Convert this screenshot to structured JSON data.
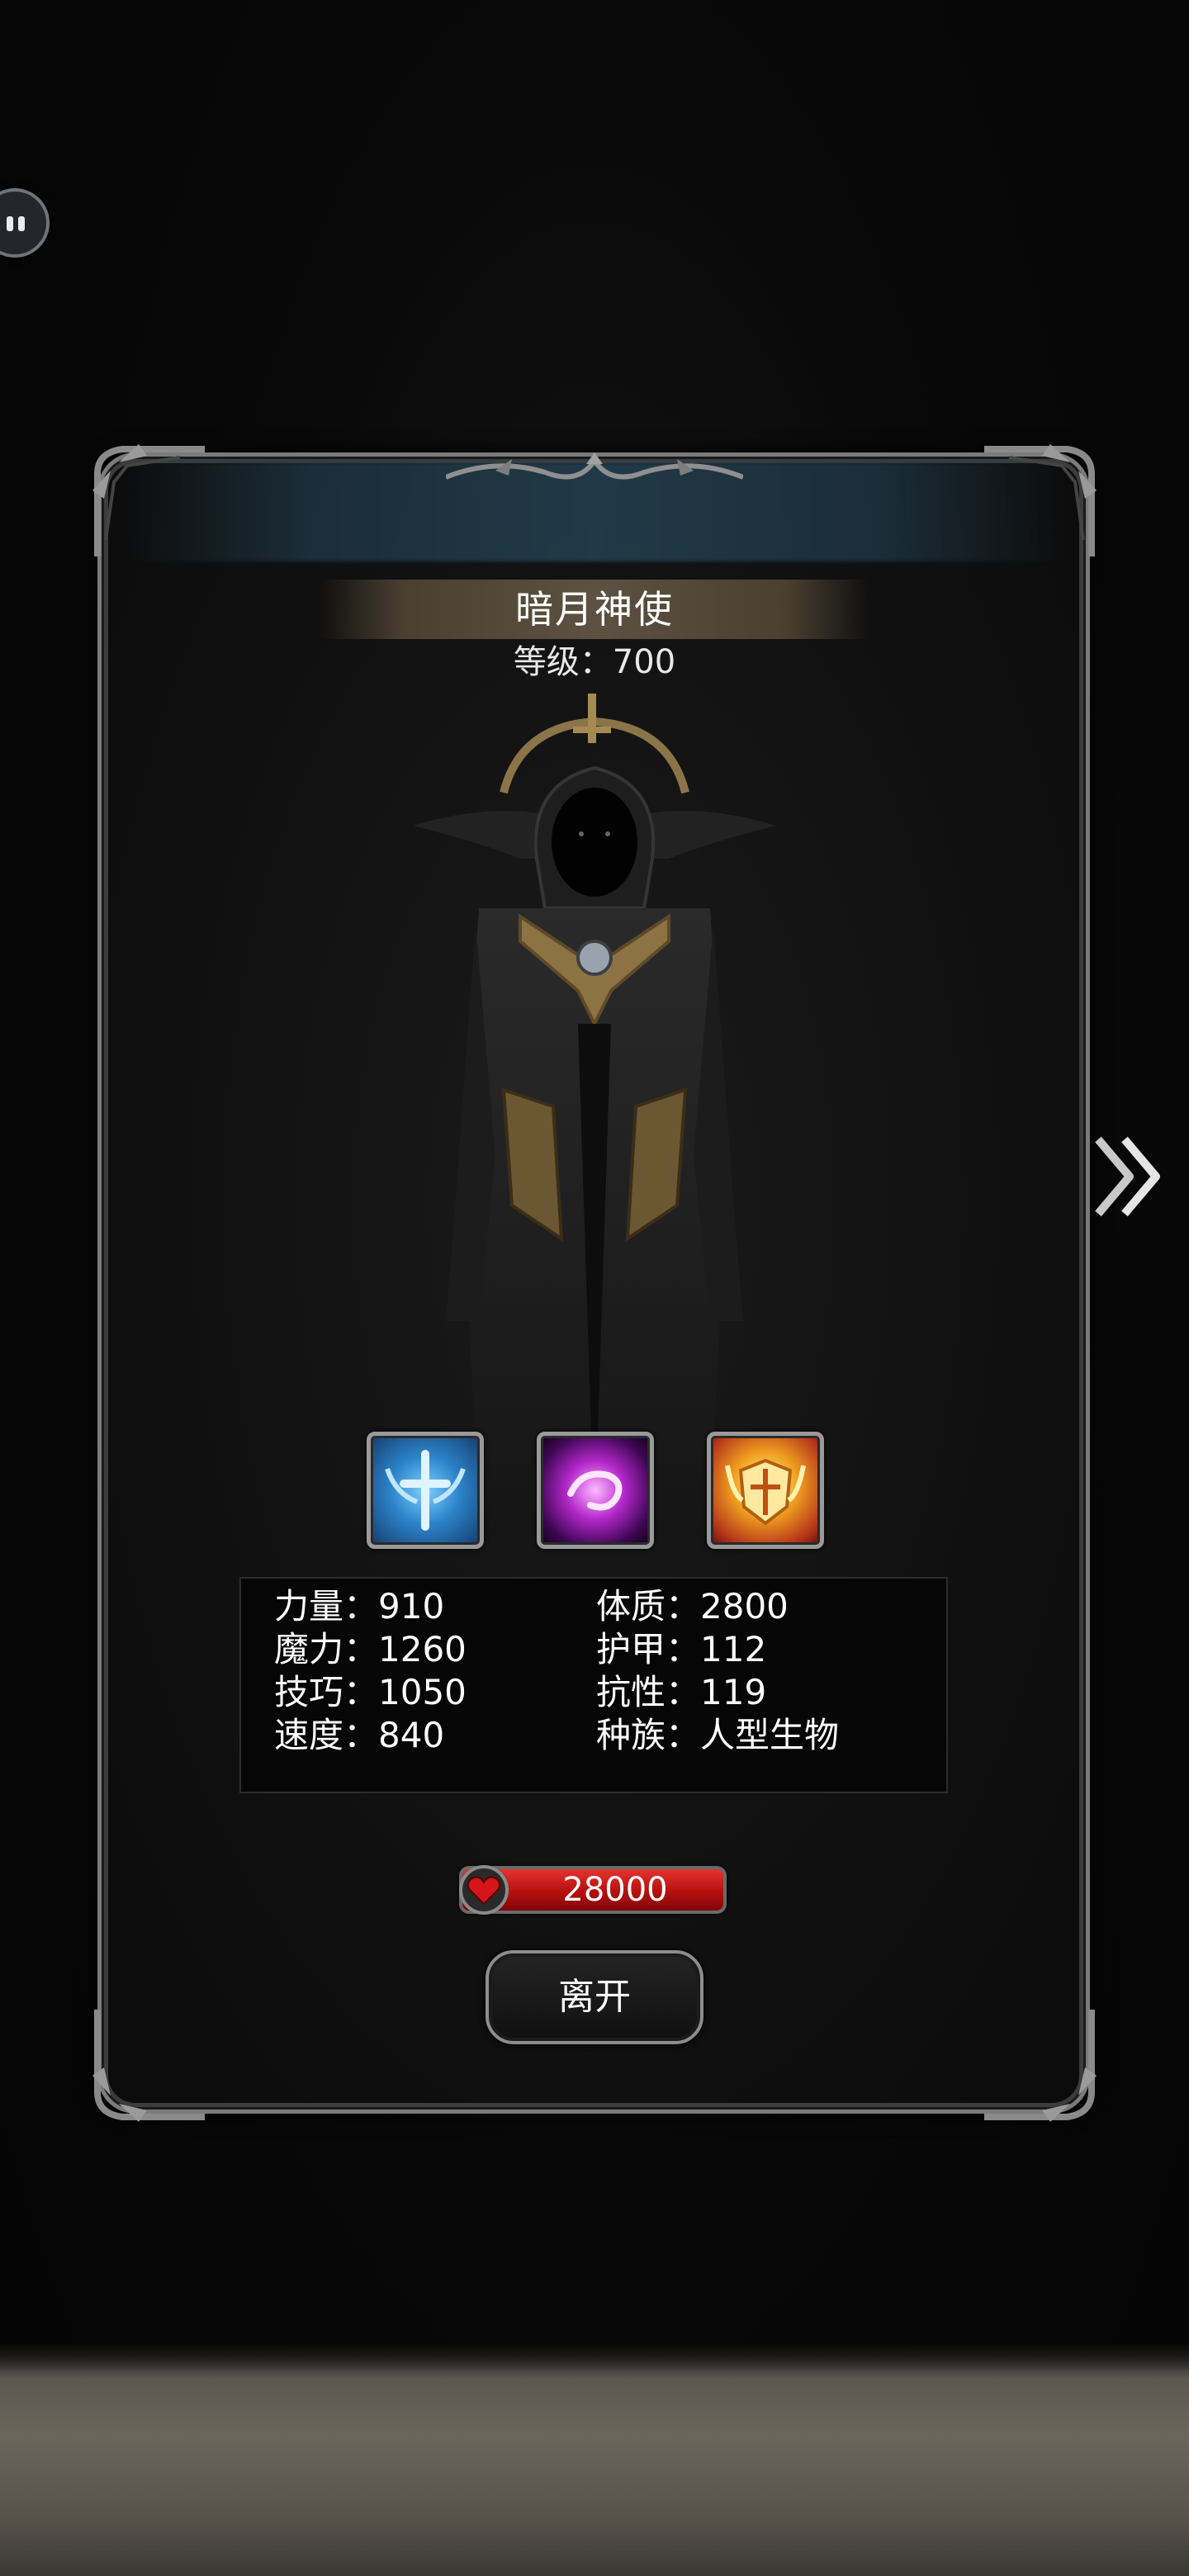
{
  "monster": {
    "name": "暗月神使",
    "level_label": "等级",
    "level_value": "700",
    "level_text": "等级：700"
  },
  "skills": [
    {
      "icon": "blue-winged-cross-skill-icon",
      "color": "#3aa0e8"
    },
    {
      "icon": "purple-orb-skill-icon",
      "color": "#c43be0"
    },
    {
      "icon": "golden-winged-shield-skill-icon",
      "color": "#f0a020"
    }
  ],
  "stats": {
    "strength": "力量：910",
    "constitution": "体质：2800",
    "magic": "魔力：1260",
    "armor": "护甲：112",
    "skill": "技巧：1050",
    "resistance": "抗性：119",
    "speed": "速度：840",
    "race": "种族：人型生物"
  },
  "hp": {
    "value": "28000",
    "icon": "heart-icon",
    "color": "#c8141a"
  },
  "buttons": {
    "leave": "离开",
    "next": "double-chevron-right-icon"
  },
  "colors": {
    "panel_border": "#7b7b7b",
    "panel_bg": "#121212",
    "text": "#ffffff",
    "title_ribbon": "#5d5142"
  }
}
